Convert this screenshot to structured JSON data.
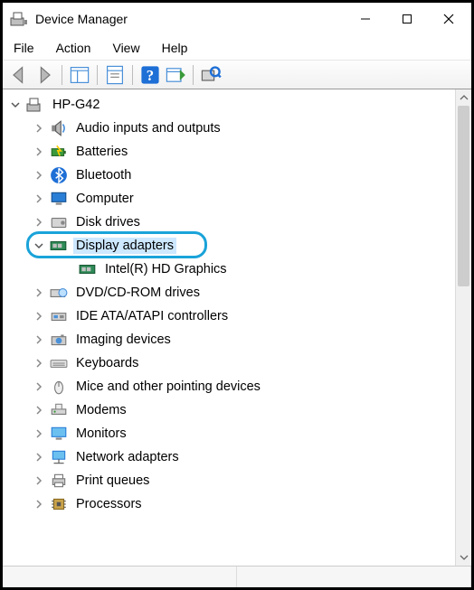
{
  "window": {
    "title": "Device Manager"
  },
  "menu": {
    "items": [
      "File",
      "Action",
      "View",
      "Help"
    ]
  },
  "tree": {
    "root": {
      "label": "HP-G42",
      "expanded": true
    },
    "items": [
      {
        "label": "Audio inputs and outputs",
        "icon": "speaker",
        "expanded": false
      },
      {
        "label": "Batteries",
        "icon": "battery",
        "expanded": false
      },
      {
        "label": "Bluetooth",
        "icon": "bluetooth",
        "expanded": false
      },
      {
        "label": "Computer",
        "icon": "monitor-blue",
        "expanded": false
      },
      {
        "label": "Disk drives",
        "icon": "disk",
        "expanded": false
      },
      {
        "label": "Display adapters",
        "icon": "display-card",
        "expanded": true,
        "highlighted": true,
        "children": [
          {
            "label": "Intel(R) HD Graphics",
            "icon": "display-card"
          }
        ]
      },
      {
        "label": "DVD/CD-ROM drives",
        "icon": "optical",
        "expanded": false
      },
      {
        "label": "IDE ATA/ATAPI controllers",
        "icon": "ide",
        "expanded": false
      },
      {
        "label": "Imaging devices",
        "icon": "camera",
        "expanded": false
      },
      {
        "label": "Keyboards",
        "icon": "keyboard",
        "expanded": false
      },
      {
        "label": "Mice and other pointing devices",
        "icon": "mouse",
        "expanded": false
      },
      {
        "label": "Modems",
        "icon": "modem",
        "expanded": false
      },
      {
        "label": "Monitors",
        "icon": "monitor",
        "expanded": false
      },
      {
        "label": "Network adapters",
        "icon": "network",
        "expanded": false
      },
      {
        "label": "Print queues",
        "icon": "printer",
        "expanded": false
      },
      {
        "label": "Processors",
        "icon": "cpu",
        "expanded": false
      }
    ]
  }
}
